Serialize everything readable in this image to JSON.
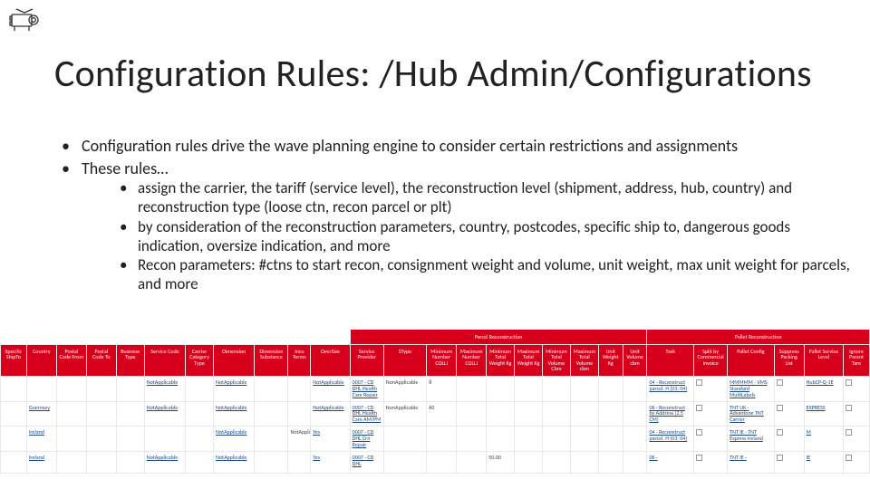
{
  "title": "Configuration Rules: /Hub Admin/Configurations",
  "bullets": {
    "b1": "Configuration rules drive the wave planning engine to consider certain restrictions and assignments",
    "b2": "These rules…",
    "sub1": "assign the carrier, the tariff (service level), the reconstruction level (shipment, address, hub, country) and reconstruction type (loose ctn, recon parcel or plt)",
    "sub2": "by consideration of the reconstruction parameters, country, postcodes, specific ship to, dangerous goods indication, oversize indication, and more",
    "sub3": "Recon parameters: #ctns to start recon, consignment weight and volume, unit weight, max unit weight for parcels, and more"
  },
  "table": {
    "group_left_blank_span": 11,
    "group_parcel": "Parcel Reconstruction",
    "group_pallet": "Pallet Reconstruction",
    "headers": [
      "Specific ShipTo",
      "Country",
      "Postal Code From",
      "Postal Code To",
      "Business Type",
      "Service Code",
      "Carrier Category Type",
      "Dimension",
      "Dimension Substance",
      "Inco Terms",
      "OverSize",
      "Service Provider",
      "SType",
      "Minimum Number COLLI",
      "Maximum Number COLLI",
      "Minimum Total Weight Kg",
      "Maximum Total Weight Kg",
      "Minimum Total Volume Cbm",
      "Maximum Total Volume cbm",
      "Unit Weight Kg",
      "Unit Volume cbm",
      "Task",
      "Split by Commercial Invoice",
      "Pallet Config",
      "Suppress Packing List",
      "Pallet Service Level",
      "Ignore Parent Tare"
    ],
    "rows": [
      {
        "c": [
          "",
          "",
          "",
          "",
          "",
          "NotApplicable",
          "",
          "NotApplicable",
          "",
          "",
          "NotApplicable",
          "0007 - CD DHL Health Care Repair",
          "NonApplicable",
          "8",
          "",
          "",
          "",
          "",
          "",
          "",
          "",
          "04 - Reconstruct parcel. H (03; 04)",
          "",
          "MMMMM - VMS Standard MultiLabels",
          "",
          "HubCP-Q-1E",
          ""
        ]
      },
      {
        "c": [
          "",
          "Guernsey",
          "",
          "",
          "",
          "NotApplicable",
          "",
          "NotApplicable",
          "",
          "",
          "NotApplicable",
          "0007 - CD DHL Health Care AM/PM",
          "NonApplicable",
          "60",
          "",
          "",
          "",
          "",
          "",
          "",
          "",
          "06 - Reconstruct by Address (2.5 CM)",
          "",
          "TNT UK - Advantone TNT Carrier",
          "",
          "EXPRESS",
          ""
        ]
      },
      {
        "c": [
          "",
          "Ireland",
          "",
          "",
          "",
          "",
          "",
          "NotApplicable",
          "",
          "NotApplicable",
          "Yes",
          "0007 - CD DHL Crn Repair",
          "",
          "",
          "",
          "",
          "",
          "",
          "",
          "",
          "",
          "04 - Reconstruct parcel. H (03; 04)",
          "",
          "TNT IE - TNT Express Ireland",
          "",
          "M",
          ""
        ]
      },
      {
        "c": [
          "",
          "Ireland",
          "",
          "",
          "",
          "NotApplicable",
          "",
          "NotApplicable",
          "",
          "",
          "Yes",
          "0007 - CD DHL",
          "",
          "",
          "",
          "50.00",
          "",
          "",
          "",
          "",
          "",
          "06 -",
          "",
          "TNT IE -",
          "",
          "IE",
          ""
        ]
      }
    ]
  }
}
